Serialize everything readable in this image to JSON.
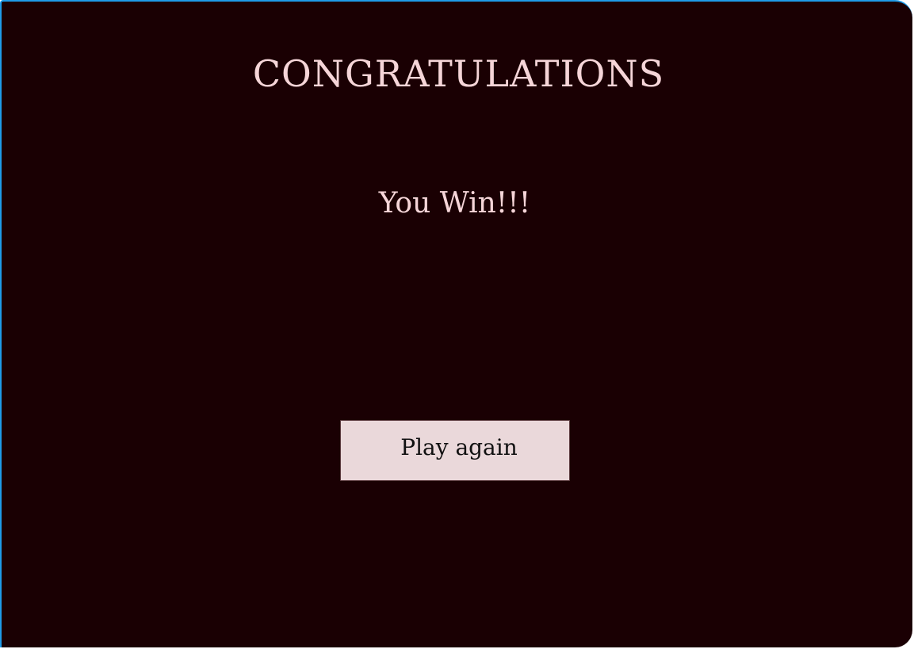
{
  "screen": {
    "title": "CONGRATULATIONS",
    "message": "You Win!!!",
    "play_again_label": "Play again"
  },
  "colors": {
    "background": "#1a0003",
    "text": "#f5d5d8",
    "button_bg": "#ead8da",
    "frame_border": "#1e9be8"
  }
}
